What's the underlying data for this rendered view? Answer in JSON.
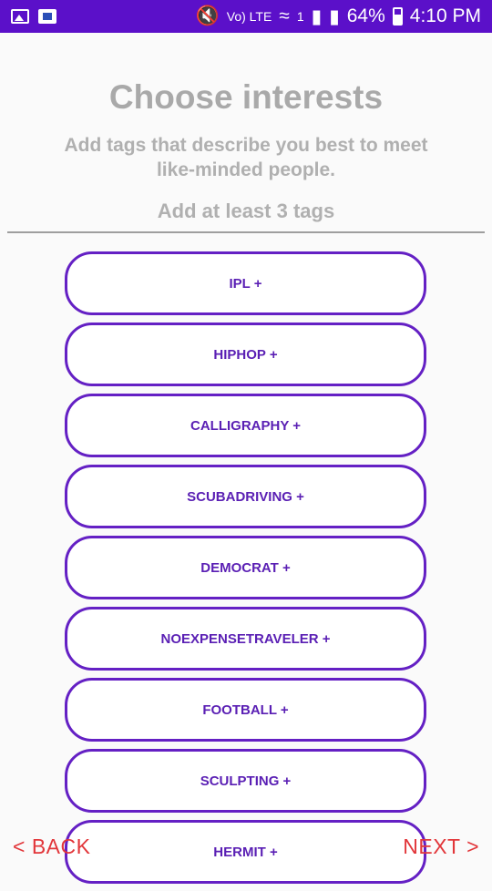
{
  "status_bar": {
    "icons": [
      "gallery-icon",
      "book-icon",
      "mute-icon",
      "volte-icon",
      "wifi-icon",
      "sim-icon",
      "signal-icon",
      "roaming-signal-icon",
      "battery-icon"
    ],
    "volte_label": "Vo) LTE",
    "sim_label": "1",
    "battery_percent": "64%",
    "time": "4:10 PM"
  },
  "header": {
    "title": "Choose interests",
    "subtitle": "Add tags that describe you best to meet like-minded people.",
    "hint": "Add at least 3 tags"
  },
  "tags": [
    {
      "label": "IPL +"
    },
    {
      "label": "HIPHOP +"
    },
    {
      "label": "CALLIGRAPHY +"
    },
    {
      "label": "SCUBADRIVING +"
    },
    {
      "label": "DEMOCRAT +"
    },
    {
      "label": "NOEXPENSETRAVELER +"
    },
    {
      "label": "FOOTBALL +"
    },
    {
      "label": "SCULPTING +"
    },
    {
      "label": "HERMIT +"
    }
  ],
  "nav": {
    "back_label": "< BACK",
    "next_label": "NEXT >"
  },
  "colors": {
    "status_bar": "#5b10c9",
    "tag_border": "#6420c4",
    "tag_text": "#5a1fb4",
    "nav_text": "#e2363a",
    "heading_text": "#a9a9a9"
  }
}
